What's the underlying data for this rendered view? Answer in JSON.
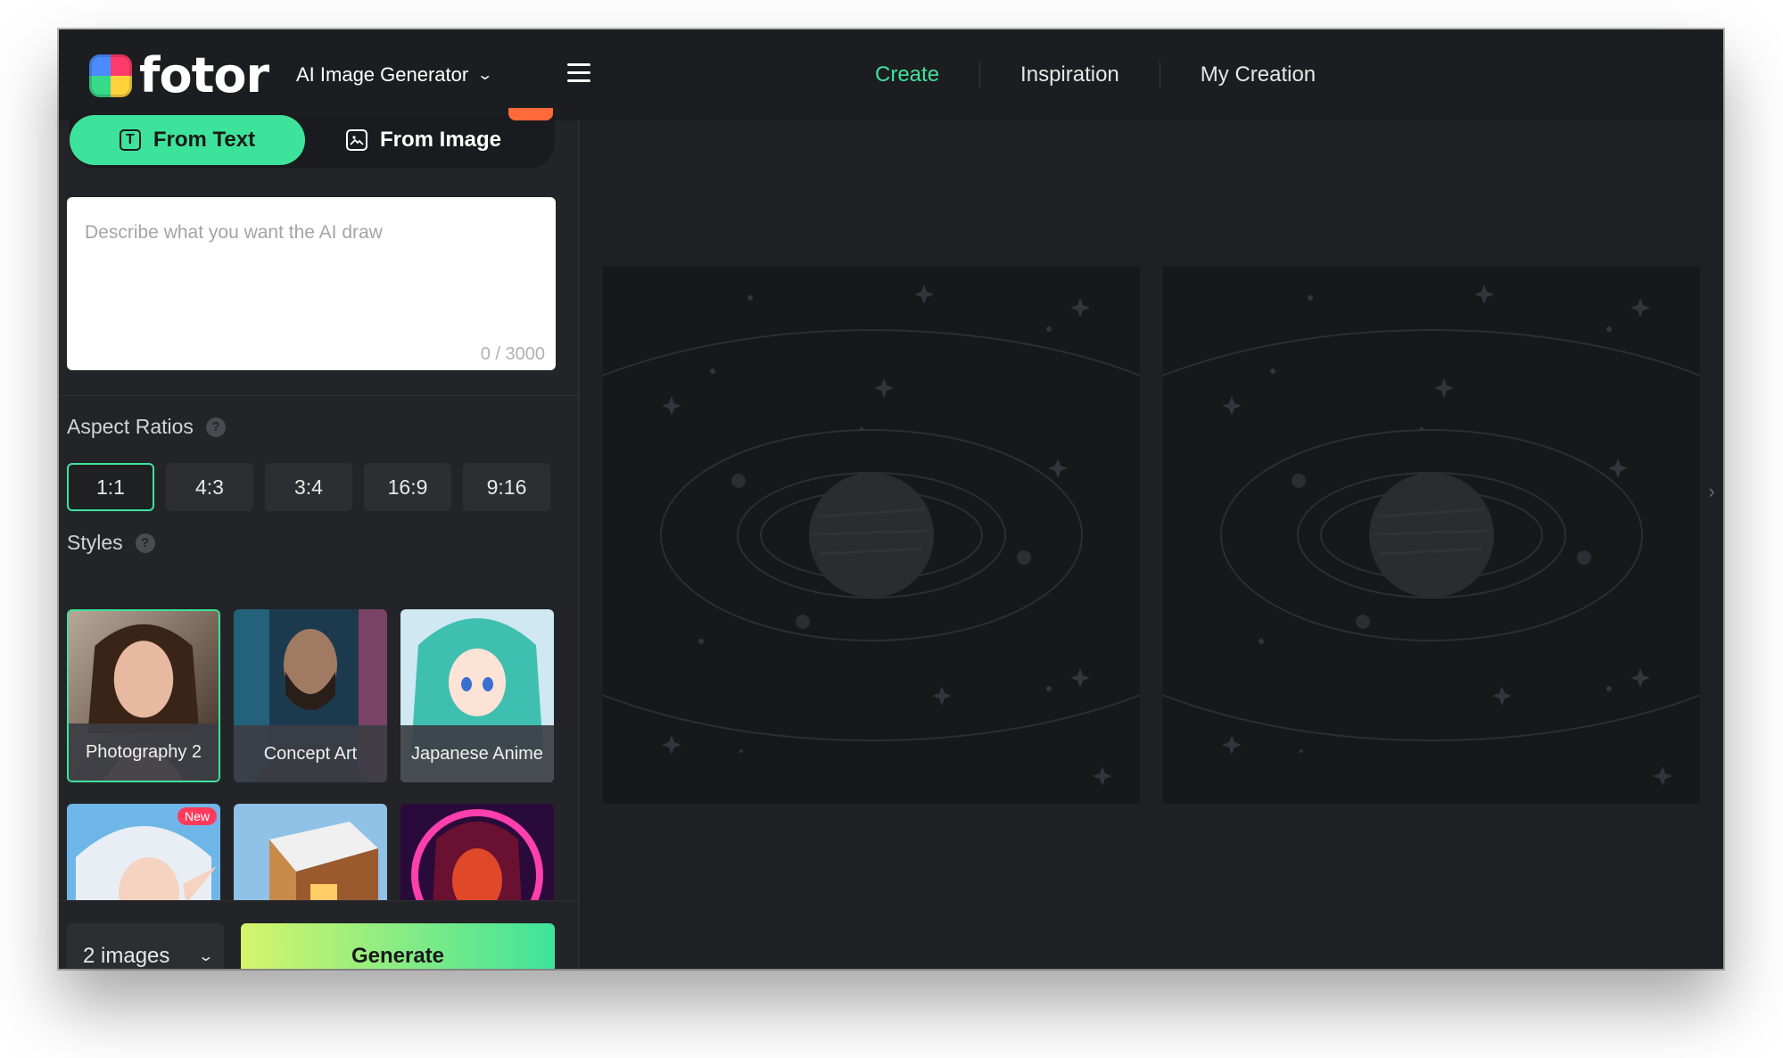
{
  "header": {
    "logo_text": "fotor",
    "product_label": "AI Image Generator",
    "nav": [
      {
        "label": "Create",
        "active": true
      },
      {
        "label": "Inspiration",
        "active": false
      },
      {
        "label": "My Creation",
        "active": false
      }
    ]
  },
  "tabs": {
    "from_text": "From Text",
    "from_image": "From Image",
    "text_icon": "T"
  },
  "prompt": {
    "placeholder": "Describe what you want the AI draw",
    "counter": "0 / 3000"
  },
  "aspect": {
    "label": "Aspect Ratios",
    "help": "?",
    "options": [
      "1:1",
      "4:3",
      "3:4",
      "16:9",
      "9:16"
    ],
    "selected": "1:1"
  },
  "styles": {
    "label": "Styles",
    "help": "?",
    "items": [
      {
        "label": "Photography 2",
        "selected": true
      },
      {
        "label": "Concept Art",
        "selected": false
      },
      {
        "label": "Japanese Anime",
        "selected": false
      },
      {
        "label": "",
        "badge": "New"
      },
      {
        "label": ""
      },
      {
        "label": ""
      }
    ]
  },
  "footer": {
    "image_count": "2 images",
    "generate_label": "Generate"
  },
  "colors": {
    "accent": "#3ee39b",
    "background": "#1f2024",
    "panel": "#232428",
    "new_badge": "#ff3b5c"
  },
  "icons": [
    "fotor-logo",
    "chevron-down-icon",
    "menu-icon",
    "text-icon",
    "image-icon",
    "help-icon",
    "chevron-right-icon",
    "planet-placeholder"
  ]
}
